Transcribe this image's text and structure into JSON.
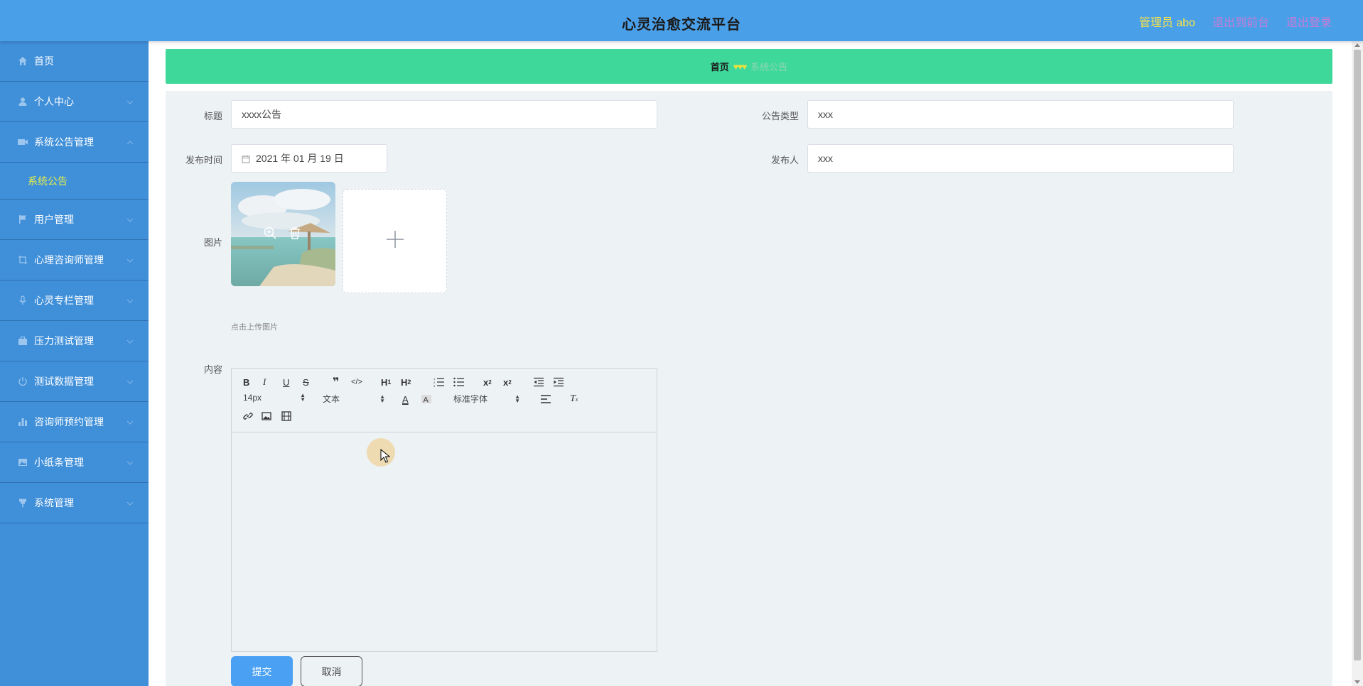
{
  "header": {
    "title": "心灵治愈交流平台",
    "admin": "管理员 abo",
    "front_link": "退出到前台",
    "logout_link": "退出登录"
  },
  "sidebar": {
    "items": [
      {
        "label": "首页",
        "icon": "home-icon"
      },
      {
        "label": "个人中心",
        "icon": "user-icon"
      },
      {
        "label": "系统公告管理",
        "icon": "video-icon",
        "expanded": true
      },
      {
        "label": "用户管理",
        "icon": "flag-icon"
      },
      {
        "label": "心理咨询师管理",
        "icon": "crop-icon"
      },
      {
        "label": "心灵专栏管理",
        "icon": "mic-icon"
      },
      {
        "label": "压力测试管理",
        "icon": "briefcase-icon"
      },
      {
        "label": "测试数据管理",
        "icon": "power-icon"
      },
      {
        "label": "咨询师预约管理",
        "icon": "bar-chart-icon"
      },
      {
        "label": "小纸条管理",
        "icon": "picture-icon"
      },
      {
        "label": "系统管理",
        "icon": "pin-icon"
      }
    ],
    "sub_item": "系统公告"
  },
  "breadcrumb": {
    "home": "首页",
    "separator": "♥♥♥",
    "current": "系统公告"
  },
  "form": {
    "title_label": "标题",
    "title_value": "xxxx公告",
    "type_label": "公告类型",
    "type_value": "xxx",
    "time_label": "发布时间",
    "time_value": "2021 年 01 月 19 日",
    "publisher_label": "发布人",
    "publisher_value": "xxx",
    "image_label": "图片",
    "upload_tip": "点击上传图片",
    "content_label": "内容"
  },
  "editor": {
    "size_select": "14px",
    "header_select": "文本",
    "font_select": "标准字体"
  },
  "buttons": {
    "submit": "提交",
    "cancel": "取消"
  }
}
